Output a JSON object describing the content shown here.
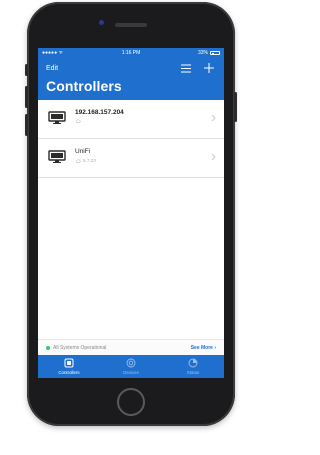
{
  "status_bar": {
    "carrier": "●●●●● ",
    "time": "1:16 PM",
    "battery": "33%"
  },
  "header": {
    "edit_label": "Edit",
    "title": "Controllers",
    "menu_icon": "hamburger-icon",
    "add_icon": "plus-icon"
  },
  "controllers": [
    {
      "name": "192.168.157.204",
      "subtitle": "",
      "icon": "monitor-icon"
    },
    {
      "name": "UniFi",
      "subtitle": "5.7.23",
      "icon": "monitor-icon"
    }
  ],
  "system_status": {
    "text": "All Systems Operational",
    "see_more": "See More ›",
    "status_color": "#2ecc71"
  },
  "tabs": [
    {
      "label": "Controllers",
      "icon": "controllers-icon",
      "active": true
    },
    {
      "label": "Devices",
      "icon": "devices-icon",
      "active": false
    },
    {
      "label": "Status",
      "icon": "status-icon",
      "active": false
    }
  ],
  "colors": {
    "accent": "#1f6fcf"
  }
}
